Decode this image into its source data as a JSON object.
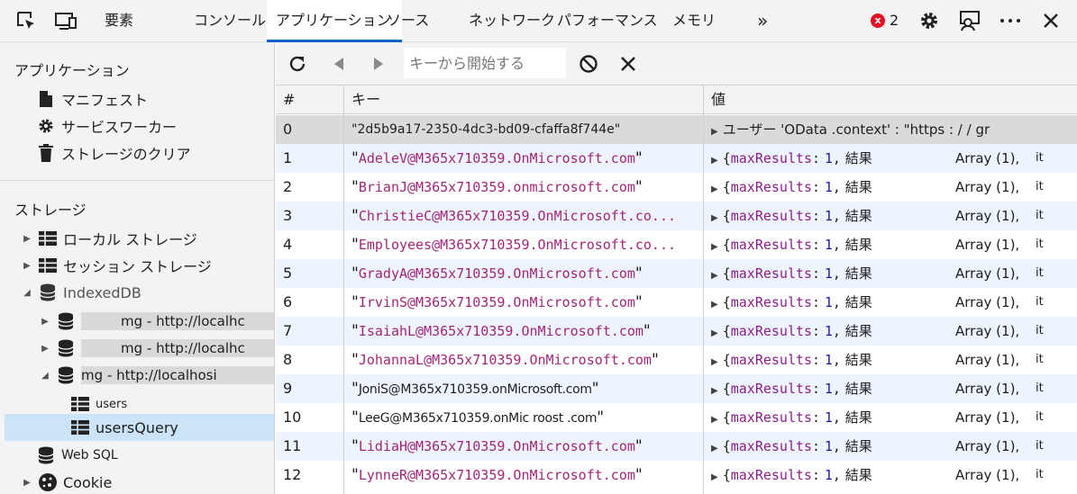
{
  "topbar": {
    "tabs": [
      "要素",
      "コンソール",
      "アプリケーション",
      "ソース",
      "ネットワーク",
      "パフォーマンス",
      "メモリ"
    ],
    "more": "»",
    "error_count": "2",
    "error_glyph": "x"
  },
  "sidebar": {
    "app_section": "アプリケーション",
    "app_items": [
      "マニフェスト",
      "サービスワーカー",
      "ストレージのクリア"
    ],
    "storage_section": "ストレージ",
    "local_storage": "ローカル ストレージ",
    "session_storage": "セッション ストレージ",
    "indexeddb": "IndexedDB",
    "dbs": [
      "mg - http://localhc",
      "mg - http://localhc",
      "mg - http://localhosi"
    ],
    "stores": [
      "users",
      "usersQuery"
    ],
    "websql": "Web SQL",
    "cookie": "Cookie"
  },
  "toolbar": {
    "search_placeholder": "キーから開始する"
  },
  "table": {
    "headers": [
      "#",
      "キー",
      "値"
    ],
    "row0": {
      "num": "0",
      "key": "\"2d5b9a17-2350-4dc3-bd09-cfaffa8f744e\"",
      "value": "ユーザー 'OData .context' : \"https : / / gr"
    },
    "rows": [
      {
        "num": "1",
        "key": "AdeleV@M365x710359.OnMicrosoft.com",
        "close": "\""
      },
      {
        "num": "2",
        "key": "BrianJ@M365x710359.onmicrosoft.com",
        "close": "\""
      },
      {
        "num": "3",
        "key": "ChristieC@M365x710359.OnMicrosoft.co...",
        "close": ""
      },
      {
        "num": "4",
        "key": "Employees@M365x710359.OnMicrosoft.co...",
        "close": ""
      },
      {
        "num": "5",
        "key": "GradyA@M365x710359.OnMicrosoft.com",
        "close": "\""
      },
      {
        "num": "6",
        "key": "IrvinS@M365x710359.OnMicrosoft.com",
        "close": "\""
      },
      {
        "num": "7",
        "key": "IsaiahL@M365x710359.OnMicrosoft.com",
        "close": "\""
      },
      {
        "num": "8",
        "key": "JohannaL@M365x710359.OnMicrosoft.com",
        "close": "\""
      },
      {
        "num": "9",
        "key": "JoniS@M365x710359.onMicrosoft.com",
        "close": "\"",
        "plain": true
      },
      {
        "num": "10",
        "key": "LeeG@M365x710359.onMic roost .com",
        "close": "\"",
        "plain": true
      },
      {
        "num": "11",
        "key": "LidiaH@M365x710359.OnMicrosoft.com",
        "close": "\""
      },
      {
        "num": "12",
        "key": "LynneR@M365x710359.OnMicrosoft.com",
        "close": "\""
      }
    ],
    "value_parts": {
      "open": "{",
      "prop": "maxResults",
      "colon": ":",
      "num": "1",
      "comma": ",",
      "result": "結果",
      "array": "Array (1),",
      "it": "it"
    }
  },
  "colors": {
    "accent": "#0a62c9",
    "selection": "#cce4f7",
    "key_string": "#a1267a",
    "error": "#e81123"
  }
}
